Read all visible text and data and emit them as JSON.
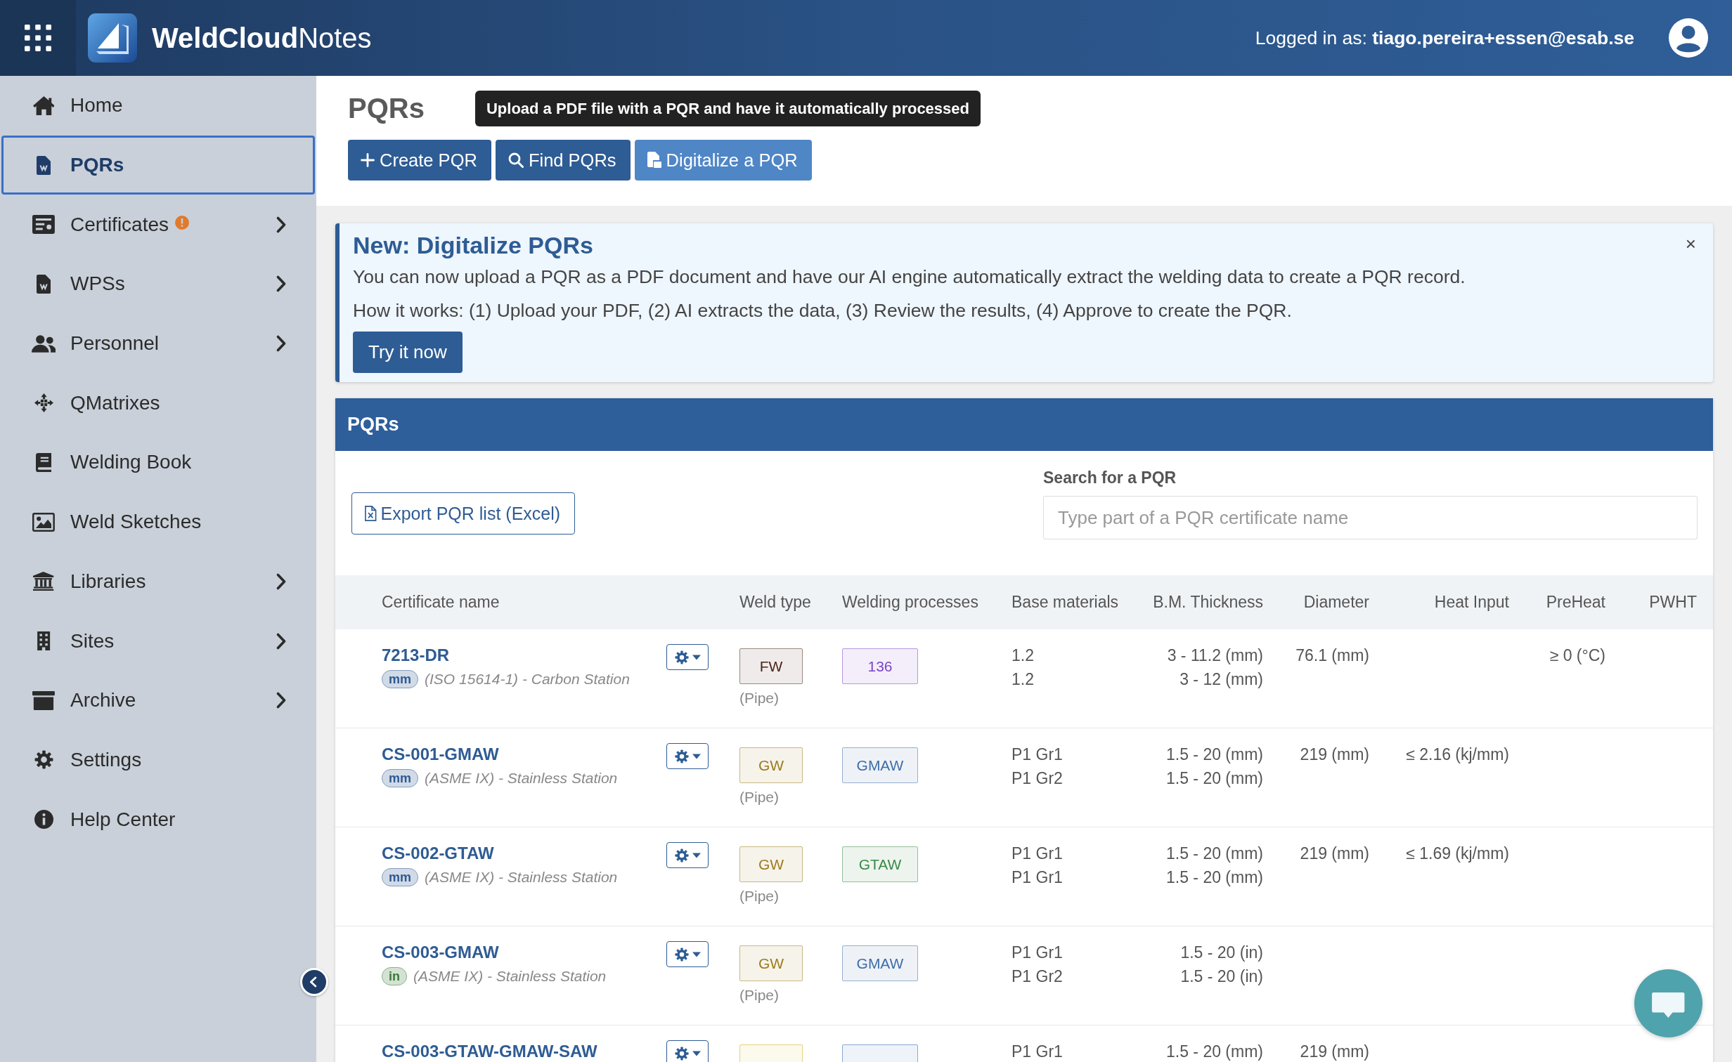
{
  "header": {
    "app_name": "**WeldCloud**Notes",
    "login": "Logged in as: **tiago.pereira+essen@esab.se**"
  },
  "sidebar": {
    "items": [
      {
        "label": "Home",
        "selected": false,
        "expandable": false,
        "alert": false
      },
      {
        "label": "PQRs",
        "selected": true,
        "expandable": false,
        "alert": false
      },
      {
        "label": "Certificates",
        "selected": false,
        "expandable": true,
        "alert": true
      },
      {
        "label": "WPSs",
        "selected": false,
        "expandable": true,
        "alert": false
      },
      {
        "label": "Personnel",
        "selected": false,
        "expandable": true,
        "alert": false
      },
      {
        "label": "QMatrixes",
        "selected": false,
        "expandable": false,
        "alert": false
      },
      {
        "label": "Welding Book",
        "selected": false,
        "expandable": false,
        "alert": false
      },
      {
        "label": "Weld Sketches",
        "selected": false,
        "expandable": false,
        "alert": false
      },
      {
        "label": "Libraries",
        "selected": false,
        "expandable": true,
        "alert": false
      },
      {
        "label": "Sites",
        "selected": false,
        "expandable": true,
        "alert": false
      },
      {
        "label": "Archive",
        "selected": false,
        "expandable": true,
        "alert": false
      },
      {
        "label": "Settings",
        "selected": false,
        "expandable": false,
        "alert": false
      },
      {
        "label": "Help Center",
        "selected": false,
        "expandable": false,
        "alert": false
      }
    ]
  },
  "page": {
    "title": "PQRs",
    "tooltip": "Upload a PDF file with a PQR and have it automatically processed",
    "actions": [
      {
        "label": "Create PQR",
        "hovered": false
      },
      {
        "label": "Find PQRs",
        "hovered": false
      },
      {
        "label": "Digitalize a PQR",
        "hovered": true
      }
    ]
  },
  "banner": {
    "title": "New: Digitalize PQRs",
    "lines": [
      "You can now upload a PQR as a PDF document and have our AI engine automatically extract the welding data to create a PQR record.",
      "How it works: (1) Upload your PDF, (2) AI extracts the data, (3) Review the results, (4) Approve to create the PQR."
    ],
    "button": "Try it now",
    "close": "×"
  },
  "panel": {
    "title": "PQRs",
    "export_button": "Export PQR list (Excel)",
    "search": {
      "label": "Search for a PQR",
      "placeholder": "Type part of a PQR certificate name"
    },
    "table": {
      "columns": [
        "Certificate name",
        "Weld type",
        "Welding processes",
        "Base materials",
        "B.M. Thickness",
        "Diameter",
        "Heat Input",
        "PreHeat",
        "PWHT"
      ],
      "rows": [
        {
          "name": "7213-DR",
          "unit": {
            "text": "mm",
            "color": "#2f5a94"
          },
          "standard": "(ISO 15614-1) - Carbon Station",
          "weld_type": {
            "text": "FW",
            "color": "#4a2418"
          },
          "weld_form": "(Pipe)",
          "process": {
            "text": "136",
            "color": "#7a44c8"
          },
          "base_materials": [
            "1.2",
            "1.2"
          ],
          "thickness": [
            "3 - 11.2 (mm)",
            "3 - 12 (mm)"
          ],
          "diameter": "76.1 (mm)",
          "preheat": "≥ 0 (°C)"
        },
        {
          "name": "CS-001-GMAW",
          "unit": {
            "text": "mm",
            "color": "#2f5a94"
          },
          "standard": "(ASME IX) - Stainless Station",
          "weld_type": {
            "text": "GW",
            "color": "#9c7c1c"
          },
          "weld_form": "(Pipe)",
          "process": {
            "text": "GMAW",
            "color": "#3f6ea8"
          },
          "base_materials": [
            "P1 Gr1",
            "P1 Gr2"
          ],
          "thickness": [
            "1.5 - 20 (mm)",
            "1.5 - 20 (mm)"
          ],
          "diameter": "219 (mm)",
          "heat_input": "≤ 2.16 (kj/mm)"
        },
        {
          "name": "CS-002-GTAW",
          "unit": {
            "text": "mm",
            "color": "#2f5a94"
          },
          "standard": "(ASME IX) - Stainless Station",
          "weld_type": {
            "text": "GW",
            "color": "#9c7c1c"
          },
          "weld_form": "(Pipe)",
          "process": {
            "text": "GTAW",
            "color": "#3a8a47"
          },
          "base_materials": [
            "P1 Gr1",
            "P1 Gr1"
          ],
          "thickness": [
            "1.5 - 20 (mm)",
            "1.5 - 20 (mm)"
          ],
          "diameter": "219 (mm)",
          "heat_input": "≤ 1.69 (kj/mm)"
        },
        {
          "name": "CS-003-GMAW",
          "unit": {
            "text": "in",
            "color": "#3a7a3a"
          },
          "standard": "(ASME IX) - Stainless Station",
          "weld_type": {
            "text": "GW",
            "color": "#9c7c1c"
          },
          "weld_form": "(Pipe)",
          "process": {
            "text": "GMAW",
            "color": "#3f6ea8"
          },
          "base_materials": [
            "P1 Gr1",
            "P1 Gr2"
          ],
          "thickness": [
            "1.5 - 20 (in)",
            "1.5 - 20 (in)"
          ]
        },
        {
          "name": "CS-003-GTAW-GMAW-SAW",
          "weld_type": {
            "color": "#e6d27e"
          },
          "process": {
            "color": "#86a9d4"
          },
          "base_materials": [
            "P1 Gr1"
          ],
          "thickness": [
            "1.5 - 20 (mm)"
          ],
          "diameter": "219 (mm)"
        }
      ]
    }
  }
}
